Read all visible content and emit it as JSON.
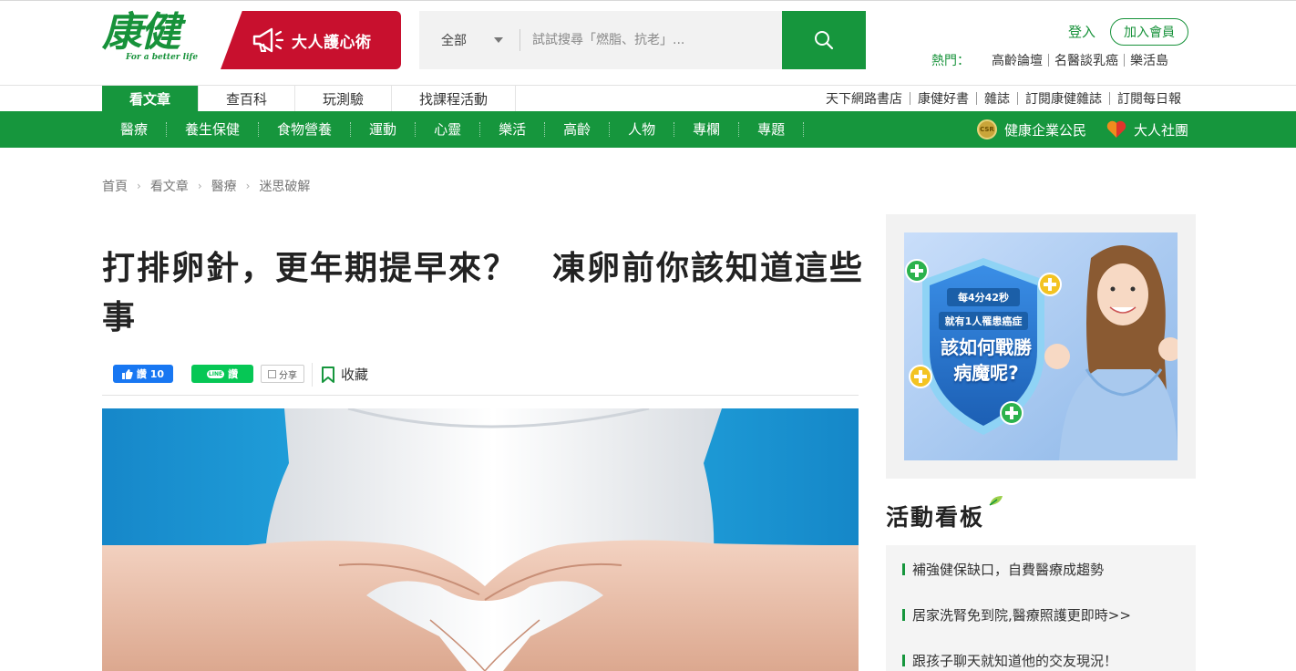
{
  "header": {
    "logo_text": "康健",
    "logo_tagline": "For a better life",
    "promo_label": "大人護心術",
    "search": {
      "category": "全部",
      "placeholder": "試試搜尋「燃脂、抗老」..."
    },
    "login_label": "登入",
    "join_label": "加入會員",
    "hot_label": "熱門：",
    "hot_items": [
      "高齡論壇",
      "名醫談乳癌",
      "樂活島"
    ]
  },
  "subnav": {
    "tabs": [
      "看文章",
      "查百科",
      "玩測驗",
      "找課程活動"
    ],
    "links": [
      "天下網路書店",
      "康健好書",
      "雜誌",
      "訂閱康健雜誌",
      "訂閱每日報"
    ]
  },
  "mainnav": {
    "items": [
      "醫療",
      "養生保健",
      "食物營養",
      "運動",
      "心靈",
      "樂活",
      "高齡",
      "人物",
      "專欄",
      "專題"
    ],
    "csr_label": "健康企業公民",
    "csr_badge": "CSR",
    "community_label": "大人社團"
  },
  "breadcrumb": [
    "首頁",
    "看文章",
    "醫療",
    "迷思破解"
  ],
  "article": {
    "title": "打排卵針，更年期提早來？　凍卵前你該知道這些事",
    "fb_label": "讚 10",
    "line_label": "讚",
    "line_logo": "LINE",
    "share_label": "分享",
    "fav_label": "收藏"
  },
  "sidebar": {
    "ad": {
      "line1": "每4分42秒",
      "line2": "就有1人罹患癌症",
      "line3": "該如何戰勝\n病魔呢?"
    },
    "events_title": "活動看板",
    "events": [
      "補強健保缺口，自費醫療成趨勢",
      "居家洗腎免到院,醫療照護更即時>>",
      "跟孩子聊天就知道他的交友現況！"
    ]
  },
  "colors": {
    "brand_green": "#16963d",
    "promo_red": "#c8102e",
    "facebook_blue": "#1877f2",
    "line_green": "#06c755"
  }
}
